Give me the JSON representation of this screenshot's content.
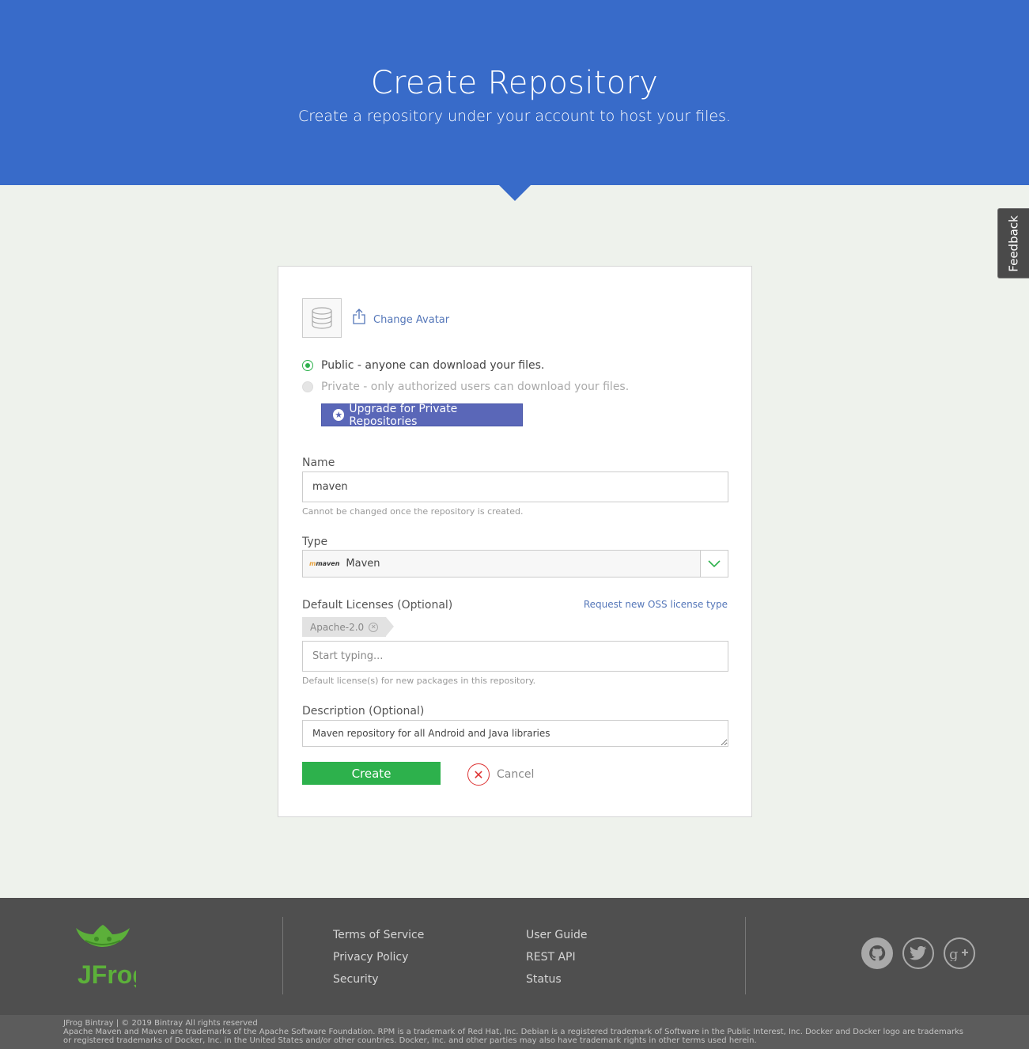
{
  "hero": {
    "title": "Create Repository",
    "subtitle": "Create a repository under your account to host your files."
  },
  "feedback": {
    "label": "Feedback"
  },
  "avatar": {
    "change_label": "Change Avatar"
  },
  "visibility": {
    "public_label": "Public - anyone can download your files.",
    "private_label": "Private - only authorized users can download your files.",
    "upgrade_label": "Upgrade for Private Repositories",
    "selected": "public"
  },
  "name_field": {
    "label": "Name",
    "value": "maven",
    "hint": "Cannot be changed once the repository is created."
  },
  "type_field": {
    "label": "Type",
    "logo_text": "maven",
    "value": "Maven"
  },
  "licenses_field": {
    "label": "Default Licenses (Optional)",
    "request_link": "Request new OSS license type",
    "tags": [
      "Apache-2.0"
    ],
    "placeholder": "Start typing...",
    "hint": "Default license(s) for new packages in this repository."
  },
  "description_field": {
    "label": "Description (Optional)",
    "value": "Maven repository for all Android and Java libraries"
  },
  "actions": {
    "create_label": "Create",
    "cancel_label": "Cancel"
  },
  "footer": {
    "logo_text": "JFrog",
    "links_col1": [
      "Terms of Service",
      "Privacy Policy",
      "Security"
    ],
    "links_col2": [
      "User Guide",
      "REST API",
      "Status"
    ],
    "social": [
      "github-icon",
      "twitter-icon",
      "google-plus-icon"
    ],
    "copyright": "JFrog Bintray | © 2019 Bintray All rights reserved",
    "legal": "Apache Maven and Maven are trademarks of the Apache Software Foundation. RPM is a trademark of Red Hat, Inc. Debian is a registered trademark of Software in the Public Interest, Inc. Docker and Docker logo are trademarks or registered trademarks of Docker, Inc. in the United States and/or other countries. Docker, Inc. and other parties may also have trademark rights in other terms used herein."
  },
  "colors": {
    "hero": "#386bc9",
    "accent_green": "#2db14c",
    "upgrade": "#5a67b8",
    "footer": "#4f4f4f"
  }
}
